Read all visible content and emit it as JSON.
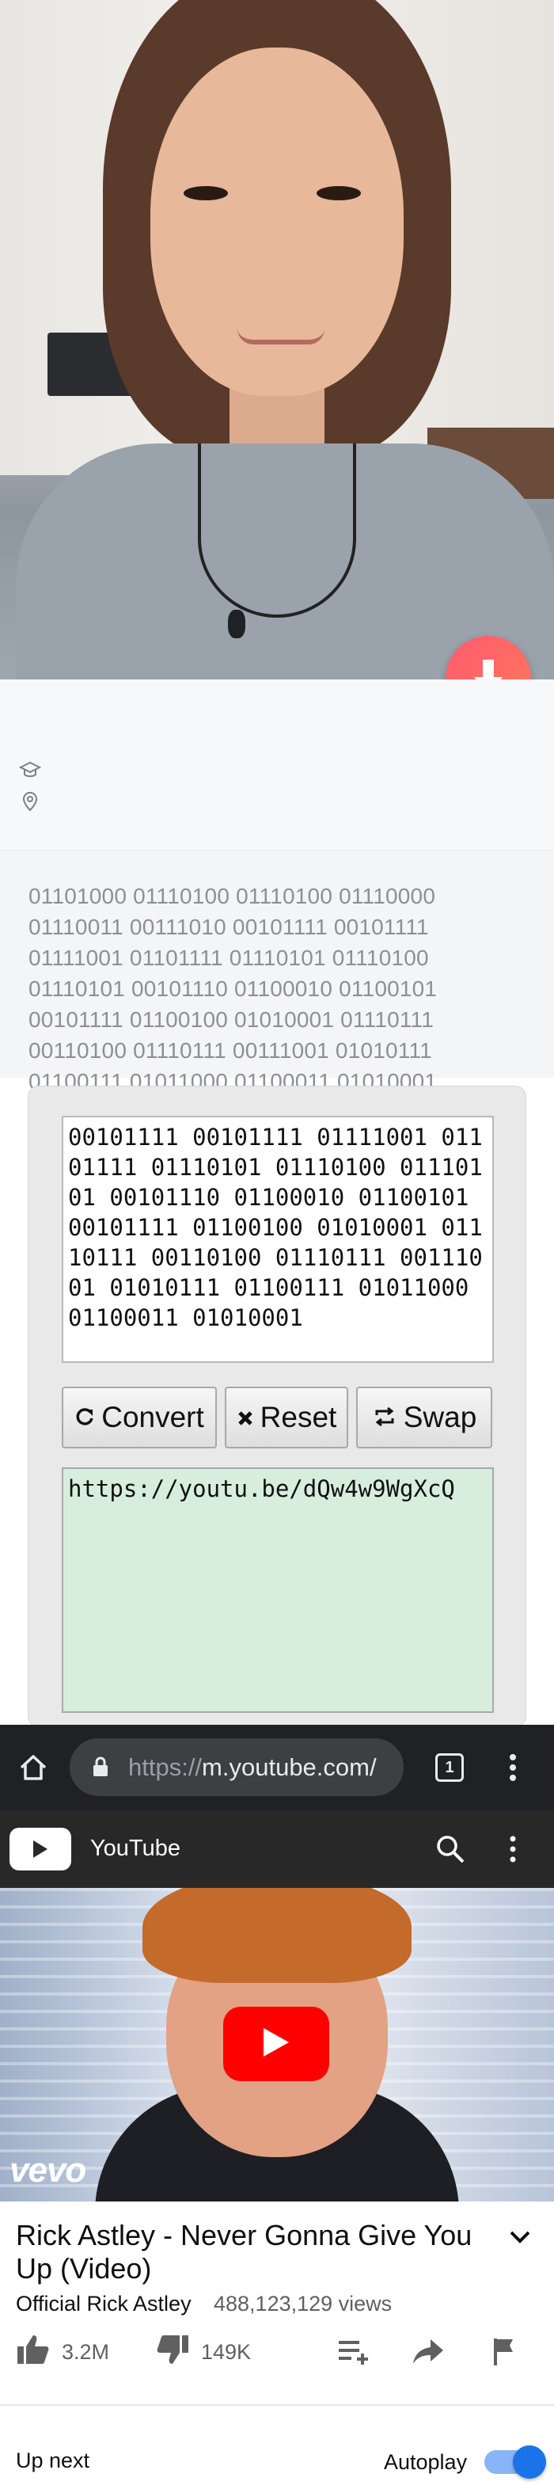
{
  "profile": {
    "binary_text": "01101000 01110100 01110100 01110000 01110011 00111010 00101111 00101111 01111001 01101111 01110101 01110100 01110101 00101110 01100010 01100101 00101111 01100100 01010001 01110111 00110100 01110111 00111001 01010111 01100111 01011000 01100011 01010001"
  },
  "converter": {
    "input_value": "00101111 00101111 01111001 01101111 01110101 01110100 01110101 00101110 01100010 01100101 00101111 01100100 01010001 01110111 00110100 01110111 00111001 01010111 01100111 01011000 01100011 01010001",
    "convert_label": "Convert",
    "reset_label": "Reset",
    "swap_label": "Swap",
    "output_value": "https://youtu.be/dQw4w9WgXcQ"
  },
  "browser": {
    "url_scheme": "https://",
    "url_host": "m.youtube.com/",
    "tab_count": "1"
  },
  "youtube": {
    "header_title": "YouTube",
    "video_watermark": "vevo",
    "video_title": "Rick Astley - Never Gonna Give You Up (Video)",
    "channel": "Official Rick Astley",
    "views": "488,123,129 views",
    "likes": "3.2M",
    "dislikes": "149K",
    "up_next": "Up next",
    "autoplay": "Autoplay",
    "autoplay_on": true
  }
}
